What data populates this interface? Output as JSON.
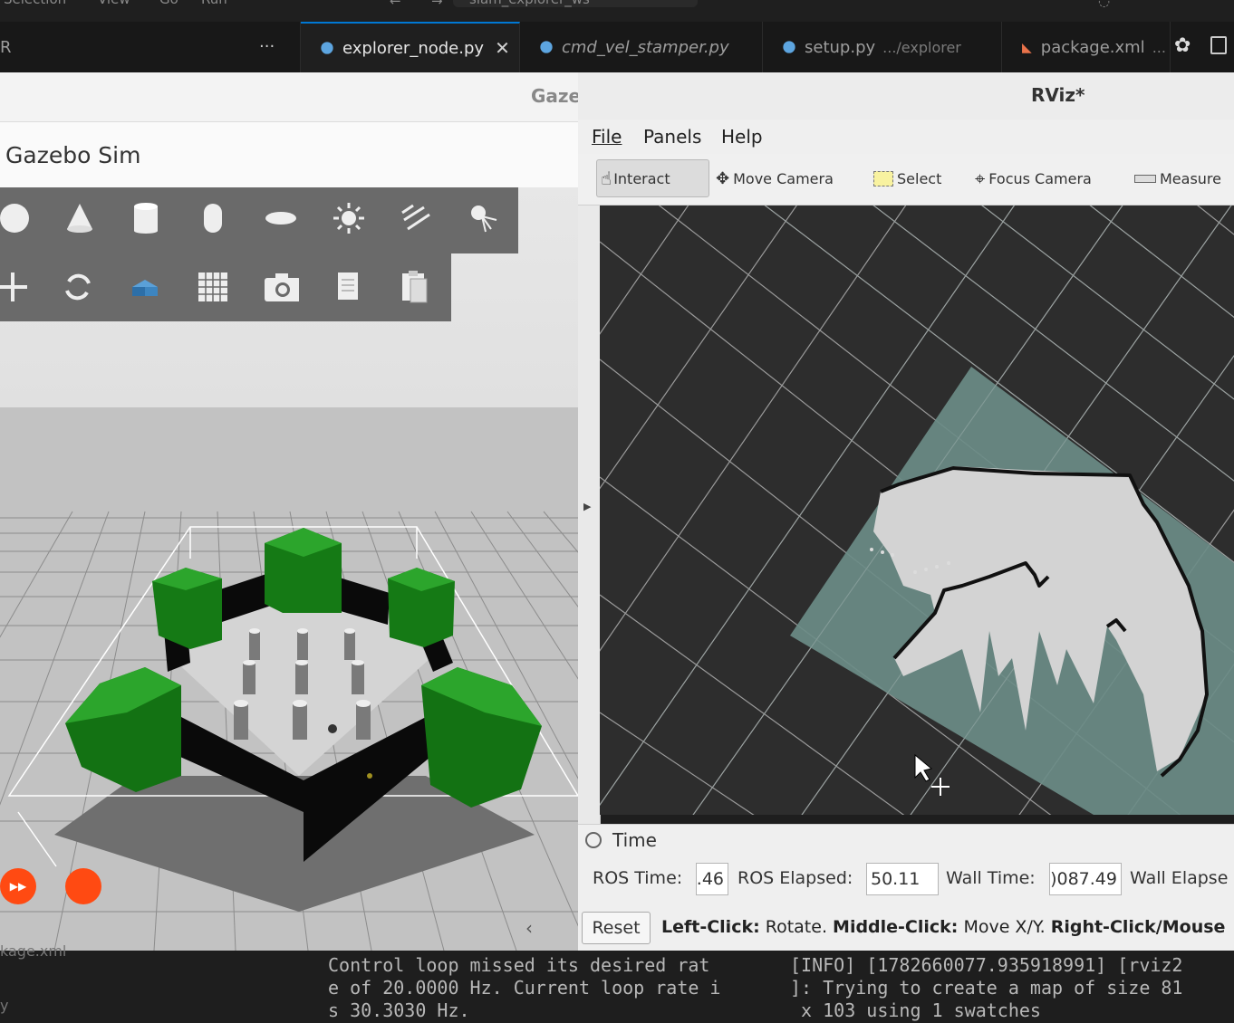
{
  "vscode": {
    "menu": [
      "Selection",
      "View",
      "Go",
      "Run"
    ],
    "title_fragment": "slam_explorer_ws",
    "sidebar_fragment": "R",
    "more": "...",
    "tabs": [
      {
        "label": "explorer_node.py",
        "desc": "",
        "close": "✕",
        "active": true,
        "icon": "python-icon"
      },
      {
        "label": "cmd_vel_stamper.py",
        "desc": "",
        "active": false,
        "italic": true,
        "icon": "python-icon"
      },
      {
        "label": "setup.py",
        "desc": ".../explorer",
        "active": false,
        "icon": "python-icon"
      },
      {
        "label": "package.xml",
        "desc": "...",
        "active": false,
        "icon": "rss-icon"
      }
    ],
    "left_fragment": "kage.xml",
    "left_fragment2": "y"
  },
  "gazebo": {
    "window_title": "Gazebo",
    "header": "Gazebo Sim",
    "toolbar_row1": [
      "sphere-icon",
      "cone-icon",
      "cylinder-icon",
      "capsule-icon",
      "ellipsoid-icon",
      "sun-light-icon",
      "directional-light-icon",
      "spot-light-icon"
    ],
    "toolbar_row2": [
      "translate-icon",
      "rotate-icon",
      "model-icon",
      "grid-icon",
      "camera-icon",
      "copy-icon",
      "paste-icon"
    ],
    "collapse": "‹",
    "colors": {
      "block": "#1e8c1e",
      "wall": "#0a0a0a",
      "ground": "#bdbdbd",
      "play": "#ff4a12"
    }
  },
  "rviz": {
    "title": "RViz*",
    "menu": [
      {
        "label": "File",
        "key": "F"
      },
      {
        "label": "Panels",
        "key": "P"
      },
      {
        "label": "Help",
        "key": "H"
      }
    ],
    "tools": [
      {
        "label": "Interact",
        "icon": "hand-icon",
        "active": true
      },
      {
        "label": "Move Camera",
        "icon": "move-camera-icon",
        "active": false
      },
      {
        "label": "Select",
        "icon": "select-icon",
        "active": false
      },
      {
        "label": "Focus Camera",
        "icon": "focus-camera-icon",
        "active": false
      },
      {
        "label": "Measure",
        "icon": "ruler-icon",
        "active": false
      }
    ],
    "time_panel": {
      "title": "Time",
      "ros_time_label": "ROS Time:",
      "ros_time": ".46",
      "ros_elapsed_label": "ROS Elapsed:",
      "ros_elapsed": "50.11",
      "wall_time_label": "Wall Time:",
      "wall_time": ")087.49",
      "wall_elapsed_label": "Wall Elapse",
      "reset": "Reset",
      "hint_b1": "Left-Click:",
      "hint_t1": " Rotate. ",
      "hint_b2": "Middle-Click:",
      "hint_t2": " Move X/Y. ",
      "hint_b3": "Right-Click/Mouse"
    },
    "colors": {
      "bg": "#2d2d2d",
      "unknown": "#6b8c87",
      "free": "#d3d3d3",
      "occupied": "#111111",
      "grid": "#8a8a8a"
    }
  },
  "terminal": {
    "left": [
      "Control loop missed its desired rat",
      "e of 20.0000 Hz. Current loop rate i",
      "s 30.3030 Hz."
    ],
    "right": [
      "[INFO] [1782660077.935918991] [rviz2",
      "]: Trying to create a map of size 81",
      " x 103 using 1 swatches"
    ]
  }
}
